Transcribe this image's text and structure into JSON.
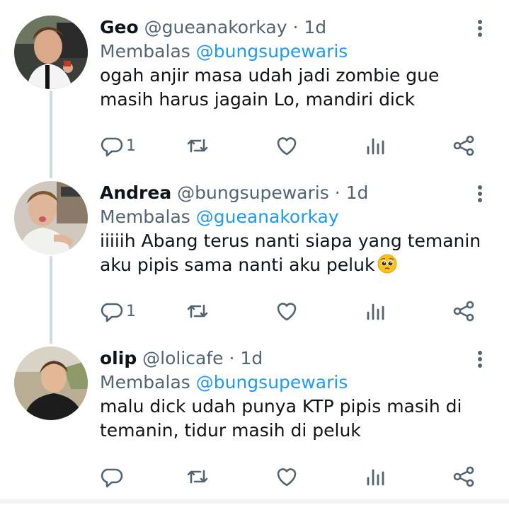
{
  "colors": {
    "accent": "#1d9bf0",
    "muted": "#536471",
    "text": "#0f1419"
  },
  "tweets": [
    {
      "name": "Geo",
      "handle": "@gueanakorkay",
      "separator": "·",
      "time": "1d",
      "reply_prefix": "Membalas",
      "reply_to": "@bungsupewaris",
      "text_lines": [
        "ogah anjir masa udah jadi zombie gue",
        "masih harus jagain Lo, mandiri dick"
      ],
      "emoji": "",
      "reply_count": "1",
      "icons": [
        "reply-icon",
        "retweet-icon",
        "like-icon",
        "analytics-icon",
        "share-icon"
      ]
    },
    {
      "name": "Andrea",
      "handle": "@bungsupewaris",
      "separator": "·",
      "time": "1d",
      "reply_prefix": "Membalas",
      "reply_to": "@gueanakorkay",
      "text_lines": [
        "iiiiih Abang terus nanti siapa yang temanin",
        "aku pipis sama nanti aku peluk"
      ],
      "emoji": "pleading-face-emoji",
      "reply_count": "1",
      "icons": [
        "reply-icon",
        "retweet-icon",
        "like-icon",
        "analytics-icon",
        "share-icon"
      ]
    },
    {
      "name": "olip",
      "handle": "@lolicafe",
      "separator": "·",
      "time": "1d",
      "reply_prefix": "Membalas",
      "reply_to": "@bungsupewaris",
      "text_lines": [
        "malu dick udah punya KTP pipis masih di",
        "temanin, tidur masih di peluk"
      ],
      "emoji": "",
      "reply_count": "",
      "icons": [
        "reply-icon",
        "retweet-icon",
        "like-icon",
        "analytics-icon",
        "share-icon"
      ]
    }
  ]
}
